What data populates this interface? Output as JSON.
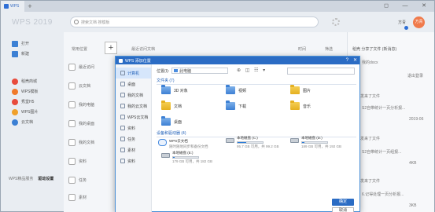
{
  "app": {
    "tab_label": "WPS",
    "plus": "+",
    "logo_text": "WPS 2019",
    "search_placeholder": "搜索文档 搜模板",
    "user_name": "方青",
    "avatar_text": "方青",
    "win_controls": [
      "◻",
      "—",
      "✕"
    ]
  },
  "sidebar": {
    "items": [
      {
        "label": "打开",
        "color": "#3c80d4"
      },
      {
        "label": "新建",
        "color": "#3c80d4"
      },
      {
        "label": "稻壳商城",
        "color": "#e84b3c"
      },
      {
        "label": "WPS模板",
        "color": "#f07a2b"
      },
      {
        "label": "秀堂H5",
        "color": "#e84b3c"
      },
      {
        "label": "WPS图片",
        "color": "#f0a02b"
      },
      {
        "label": "云文档",
        "color": "#3c80d4"
      }
    ],
    "footer_left": "WPS精品服务",
    "footer_right": "驱动设置"
  },
  "main": {
    "header_left": "常用位置",
    "new_button": "+",
    "header_mid": "最近访问文档",
    "header_right_1": "时间",
    "header_right_2": "筛选",
    "nav": [
      {
        "label": "最近访问"
      },
      {
        "label": "云文档"
      },
      {
        "label": "我的电脑"
      },
      {
        "label": "我的桌面"
      },
      {
        "label": "我的文档"
      },
      {
        "label": "资料"
      },
      {
        "label": "任务"
      },
      {
        "label": "素材"
      }
    ]
  },
  "right_panel": {
    "title": "稻壳 分享了文件 (新消息)",
    "rows": [
      "我的docx",
      "退出登录",
      "对方发来了文件",
      "S2自带统计一页分析报...",
      "对方发来了文件",
      "S2自带统计一页组报...",
      "对方发来了文件",
      "6.记得处理一页分析报..."
    ],
    "meta": [
      "2019-06",
      "4KB",
      "3KB",
      "2KB"
    ]
  },
  "dialog": {
    "title": "WPS 添加位置",
    "help": "?",
    "close": "✕",
    "side_items": [
      {
        "label": "计算机",
        "active": true
      },
      {
        "label": "桌面",
        "active": false
      },
      {
        "label": "我的文档",
        "active": false
      },
      {
        "label": "我的云文档",
        "active": false
      },
      {
        "label": "WPS云文档",
        "active": false
      },
      {
        "label": "资料",
        "active": false
      },
      {
        "label": "任务",
        "active": false
      },
      {
        "label": "素材",
        "active": false
      },
      {
        "label": "资料",
        "active": false
      }
    ],
    "path_label": "位置(I):",
    "path_value": "此电脑",
    "tools": "⊕ ◫ ☷ ▾",
    "folders_header": "文件夹 (7)",
    "folders": [
      {
        "label": "3D 对象",
        "blue": true
      },
      {
        "label": "视频",
        "blue": true
      },
      {
        "label": "图片",
        "blue": false
      },
      {
        "label": "文档",
        "blue": false
      },
      {
        "label": "下载",
        "blue": true
      },
      {
        "label": "音乐",
        "blue": false
      },
      {
        "label": "桌面",
        "blue": true
      }
    ],
    "drives_header": "设备和驱动器 (4)",
    "cloud_title": "WPS云文档",
    "cloud_sub": "随时随地同步和备份文档",
    "drives": [
      {
        "name": "本地磁盘 (C:)",
        "free": "95.7 GB 可用，共 99.2 GB",
        "used": 0.35
      },
      {
        "name": "本地磁盘 (D:)",
        "free": "189 GB 可用，共 192 GB",
        "used": 0.08
      },
      {
        "name": "本地磁盘 (E:)",
        "free": "179 GB 可用，共 182 GB",
        "used": 0.07
      }
    ],
    "open_button": "确定",
    "cancel_button": "取消"
  },
  "colors": {
    "accent": "#2b6cc4",
    "titlebar": "#cfd6df",
    "avatar": "#f07a4b"
  }
}
